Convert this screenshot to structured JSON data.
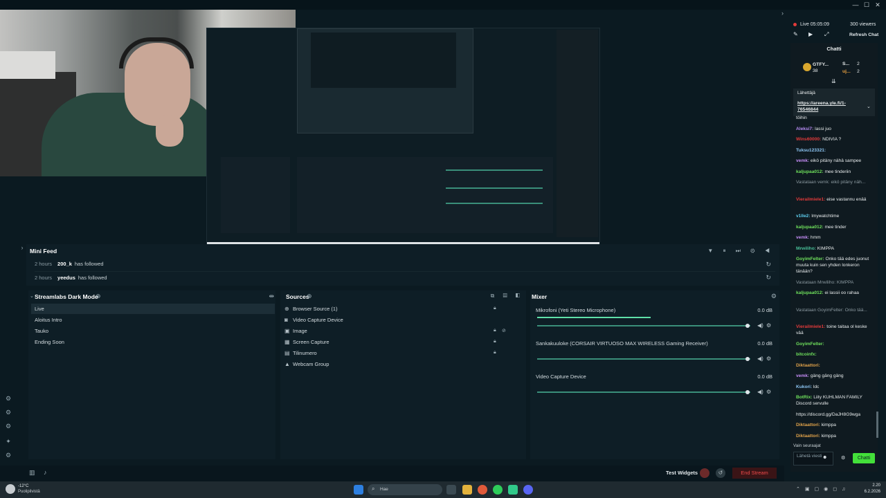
{
  "window": {
    "minimize": "—",
    "maximize": "☐",
    "close": "✕"
  },
  "stream": {
    "status": "Live 05:05:09",
    "viewers": "300 viewers",
    "refresh_chat": "Refresh Chat"
  },
  "minifeed": {
    "title": "Mini Feed",
    "items": [
      {
        "time": "2 hours",
        "user": "200_k",
        "action": "has followed"
      },
      {
        "time": "2 hours",
        "user": "yeedus",
        "action": "has followed"
      }
    ]
  },
  "scenes": {
    "title": "Streamlabs Dark Mode",
    "items": [
      "Live",
      "Aloitus Intro",
      "Tauko",
      "Ending Soon"
    ]
  },
  "sources": {
    "title": "Sources",
    "items": [
      "Browser Source (1)",
      "Video Capture Device",
      "Image",
      "Screen Capture",
      "Tilinumero",
      "Webcam Group"
    ]
  },
  "mixer": {
    "title": "Mixer",
    "channels": [
      {
        "name": "Mikrofoni (Yeti Stereo Microphone)",
        "db": "0.0 dB"
      },
      {
        "name": "Sankakuuloke (CORSAIR VIRTUOSO MAX WIRELESS Gaming Receiver)",
        "db": "0.0 dB"
      },
      {
        "name": "Video Capture Device",
        "db": "0.0 dB"
      }
    ]
  },
  "bottom": {
    "test_widgets": "Test Widgets",
    "end_stream": "End Stream"
  },
  "chat": {
    "title": "Chatti",
    "top_user_1": "GTFY...",
    "top_user_1_count": "38",
    "top_user_2": "S...",
    "top_user_2_count": "2",
    "top_user_3": "uj...",
    "top_user_3_count": "2",
    "pinned_label": "Lähettäjä",
    "pinned_link": "https://areena.yle.fi/1-76546844",
    "messages": [
      {
        "user": "",
        "text": "töihin",
        "color": "#e8eced"
      },
      {
        "user": "Aleksi7:",
        "text": "lassi juo",
        "color": "#b88cf5"
      },
      {
        "user": "Wins60000:",
        "text": "NDIVIA ?",
        "color": "#e23a3a"
      },
      {
        "user": "Tuksu123321:",
        "text": "",
        "color": "#8ec7f5"
      },
      {
        "user": "vemk:",
        "text": "eikö pitäny nähä sampee",
        "color": "#c58cf5"
      },
      {
        "user": "kaljupaa012:",
        "text": "mee tinderiin",
        "color": "#6fe05c"
      },
      {
        "user": "",
        "text": "Vastataan vemk: eikö pitäny näh...",
        "color": "#8c9aa1"
      },
      {
        "user": "Vierailmiele1:",
        "text": "eise vastannu enää",
        "color": "#e23a3a"
      },
      {
        "user": "v1lle2:",
        "text": "lmywatchtime",
        "color": "#5fd0f0"
      },
      {
        "user": "kaljupaa012:",
        "text": "mee tinder",
        "color": "#6fe05c"
      },
      {
        "user": "vemk:",
        "text": "hmm",
        "color": "#c58cf5"
      },
      {
        "user": "Mrwiliho:",
        "text": "KIMPPA",
        "color": "#4ac29a"
      },
      {
        "user": "GoyimFelter:",
        "text": "Onko tää edes juonut muuta kuin sen yhden lonkeron tänään?",
        "color": "#6fe05c"
      },
      {
        "user": "",
        "text": "Vastataan Mrwiliho: KIMPPA",
        "color": "#8c9aa1"
      },
      {
        "user": "kaljupaa012:",
        "text": "ei lassii oo rahaa",
        "color": "#6fe05c"
      },
      {
        "user": "",
        "text": "Vastataan GoyimFelter: Onko tää...",
        "color": "#8c9aa1"
      },
      {
        "user": "Vierailmiele1:",
        "text": "toine taitaa ol keske vää",
        "color": "#e23a3a"
      },
      {
        "user": "GoyimFelter:",
        "text": "",
        "color": "#6fe05c"
      },
      {
        "user": "bitcoinfx:",
        "text": "",
        "color": "#6fe05c"
      },
      {
        "user": "Diktaattori:",
        "text": "",
        "color": "#e0a24a"
      },
      {
        "user": "vemk:",
        "text": "gäng gäng gäng",
        "color": "#c58cf5"
      },
      {
        "user": "Kukori:",
        "text": "ldc",
        "color": "#8ec7f5"
      },
      {
        "user": "BotRix:",
        "text": "Liity KUHLMAN FAMILY Discord servulle",
        "color": "#6fe05c"
      },
      {
        "user": "",
        "text": "https://discord.gg/DaJH8G9wga",
        "color": "#e8eced"
      },
      {
        "user": "Diktaattori:",
        "text": "kimppa",
        "color": "#e0a24a"
      },
      {
        "user": "Diktaattori:",
        "text": "kimppa",
        "color": "#e0a24a"
      },
      {
        "user": "ABDINIINISTO:",
        "text": "pääseeks comppi mukaa",
        "color": "#c58cf5"
      },
      {
        "user": "kaljupaa012:",
        "text": "tinder",
        "color": "#6fe05c"
      },
      {
        "user": "Tonttonic:",
        "text": "",
        "color": "#4ac29a"
      }
    ],
    "followers_only": "Vain seuraajat",
    "input_placeholder": "Lähetä viesti",
    "send": "Chatti"
  },
  "taskbar": {
    "weather_temp": "-12°C",
    "weather_desc": "Puolipilvistä",
    "search_placeholder": "Hae",
    "time": "2.20",
    "date": "6.2.2026"
  }
}
